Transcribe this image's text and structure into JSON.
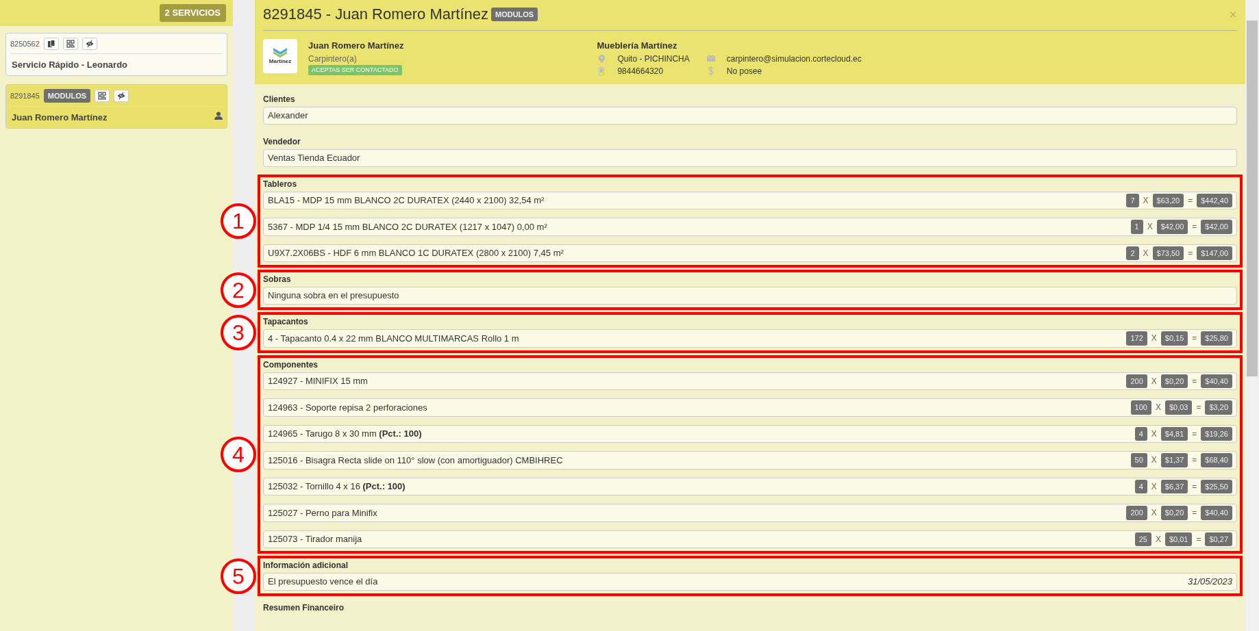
{
  "sidebar": {
    "count_badge": "2 SERVICIOS",
    "services": [
      {
        "number": "8250562",
        "selected": false,
        "actions": [
          {
            "kind": "documents"
          },
          {
            "kind": "qr"
          },
          {
            "kind": "eye"
          }
        ],
        "name": "Servicio Rápido - Leonardo",
        "user_icon": false
      },
      {
        "number": "8291845",
        "tag": "MODULOS",
        "selected": true,
        "actions": [
          {
            "kind": "qr"
          },
          {
            "kind": "eye"
          }
        ],
        "name": "Juan Romero Martínez",
        "user_icon": true
      }
    ]
  },
  "modal": {
    "title": "8291845 - Juan Romero Martínez",
    "tag": "MODULOS",
    "close": "×",
    "profile": {
      "logo_text": "Martínez",
      "name": "Juan Romero Martínez",
      "role": "Carpintero(a)",
      "contact_badge": "ACEPTAS SER CONTACTADO",
      "company": "Mueblería Martínez",
      "location": "Quito - PICHINCHA",
      "phone": "9844664320",
      "email": "carpintero@simulacion.cortecloud.ec",
      "payment": "No posee"
    },
    "sections": [
      {
        "title": "Clientes",
        "kind": "text",
        "value": "Alexander"
      },
      {
        "title": "Vendedor",
        "kind": "text",
        "value": "Ventas Tienda Ecuador"
      },
      {
        "title": "Tableros",
        "kind": "items",
        "callout": "1",
        "items": [
          {
            "description": "BLA15 - MDP 15 mm BLANCO 2C DURATEX (2440 x 2100) 32,54 m²",
            "qty": "7",
            "times": "X",
            "price": "$63,20",
            "equals": "=",
            "total": "$442,40"
          },
          {
            "description": "5367 - MDP 1/4 15 mm BLANCO 2C DURATEX (1217 x 1047) 0,00 m²",
            "qty": "1",
            "times": "X",
            "price": "$42,00",
            "equals": "=",
            "total": "$42,00"
          },
          {
            "description": "U9X7.2X06BS - HDF 6 mm BLANCO 1C DURATEX (2800 x 2100) 7,45 m²",
            "qty": "2",
            "times": "X",
            "price": "$73,50",
            "equals": "=",
            "total": "$147,00"
          }
        ]
      },
      {
        "title": "Sobras",
        "kind": "text",
        "callout": "2",
        "value": "Ninguna sobra en el presupuesto"
      },
      {
        "title": "Tapacantos",
        "kind": "items",
        "callout": "3",
        "items": [
          {
            "description": "4 - Tapacanto 0.4 x 22 mm BLANCO MULTIMARCAS Rollo 1 m",
            "qty": "172",
            "times": "X",
            "price": "$0,15",
            "equals": "=",
            "total": "$25,80"
          }
        ]
      },
      {
        "title": "Componentes",
        "kind": "items",
        "callout": "4",
        "items": [
          {
            "description": "124927 - MINIFIX 15 mm",
            "qty": "200",
            "times": "X",
            "price": "$0,20",
            "equals": "=",
            "total": "$40,40"
          },
          {
            "description": "124963 - Soporte repisa 2 perforaciones",
            "qty": "100",
            "times": "X",
            "price": "$0,03",
            "equals": "=",
            "total": "$3,20"
          },
          {
            "description": "124965 - Tarugo 8 x 30 mm **(Pct.: 100)**",
            "qty": "4",
            "times": "X",
            "price": "$4,81",
            "equals": "=",
            "total": "$19,26"
          },
          {
            "description": "125016 - Bisagra Recta slide on 110° slow (con amortiguador) CMBIHREC",
            "qty": "50",
            "times": "X",
            "price": "$1,37",
            "equals": "=",
            "total": "$68,40"
          },
          {
            "description": "125032 - Tornillo 4 x 16 **(Pct.: 100)**",
            "qty": "4",
            "times": "X",
            "price": "$6,37",
            "equals": "=",
            "total": "$25,50"
          },
          {
            "description": "125027 - Perno para Minifix",
            "qty": "200",
            "times": "X",
            "price": "$0,20",
            "equals": "=",
            "total": "$40,40"
          },
          {
            "description": "125073 - Tirador manija",
            "qty": "25",
            "times": "X",
            "price": "$0,01",
            "equals": "=",
            "total": "$0,27"
          }
        ]
      },
      {
        "title": "Información adicional",
        "kind": "note",
        "callout": "5",
        "value": "El presupuesto vence el día",
        "date": "31/05/2023"
      },
      {
        "title": "Resumen Financeiro",
        "kind": "heading"
      }
    ]
  }
}
